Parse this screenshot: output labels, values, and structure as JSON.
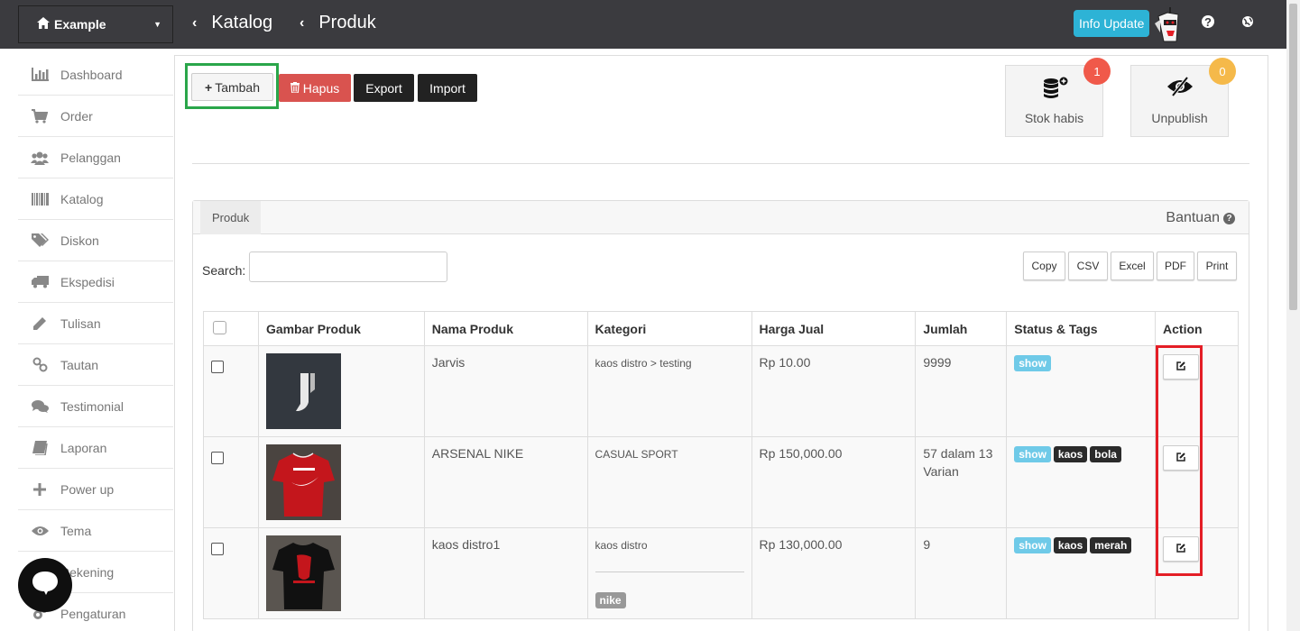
{
  "topbar": {
    "brand_label": "Example",
    "crumb_1": "Katalog",
    "crumb_2": "Produk",
    "info_update": "Info Update",
    "help_icon": "?",
    "globe_icon": "globe-icon"
  },
  "sidebar": {
    "items": [
      {
        "label": "Dashboard",
        "icon": "bar-chart-icon"
      },
      {
        "label": "Order",
        "icon": "cart-icon"
      },
      {
        "label": "Pelanggan",
        "icon": "users-icon"
      },
      {
        "label": "Katalog",
        "icon": "barcode-icon"
      },
      {
        "label": "Diskon",
        "icon": "tags-icon"
      },
      {
        "label": "Ekspedisi",
        "icon": "truck-icon"
      },
      {
        "label": "Tulisan",
        "icon": "pencil-icon"
      },
      {
        "label": "Tautan",
        "icon": "link-icon"
      },
      {
        "label": "Testimonial",
        "icon": "comments-icon"
      },
      {
        "label": "Laporan",
        "icon": "book-icon"
      },
      {
        "label": "Power up",
        "icon": "plus-icon"
      },
      {
        "label": "Tema",
        "icon": "eye-icon"
      },
      {
        "label": "Rekening",
        "icon": "bank-icon"
      },
      {
        "label": "Pengaturan",
        "icon": "cogs-icon"
      }
    ]
  },
  "toolbar": {
    "tambah": "Tambah",
    "hapus": "Hapus",
    "export": "Export",
    "import": "Import"
  },
  "stats": {
    "stok_habis": {
      "label": "Stok habis",
      "count": "1",
      "color": "#f0594a"
    },
    "unpublish": {
      "label": "Unpublish",
      "count": "0",
      "color": "#f5b94a"
    }
  },
  "panel": {
    "tab": "Produk",
    "bantuan": "Bantuan",
    "search_label": "Search:",
    "search_value": "",
    "export_buttons": [
      "Copy",
      "CSV",
      "Excel",
      "PDF",
      "Print"
    ]
  },
  "table": {
    "headers": [
      "Gambar Produk",
      "Nama Produk",
      "Kategori",
      "Harga Jual",
      "Jumlah",
      "Status & Tags",
      "Action"
    ],
    "rows": [
      {
        "name": "Jarvis",
        "kategori": "kaos distro > testing",
        "harga": "Rp 10.00",
        "jumlah": "9999",
        "tags": [
          "show"
        ]
      },
      {
        "name": "ARSENAL NIKE",
        "kategori": "CASUAL SPORT",
        "harga": "Rp 150,000.00",
        "jumlah": "57 dalam 13 Varian",
        "tags": [
          "show",
          "kaos",
          "bola"
        ]
      },
      {
        "name": "kaos distro1",
        "kategori": "kaos distro",
        "kategori_tag": "nike",
        "harga": "Rp 130,000.00",
        "jumlah": "9",
        "tags": [
          "show",
          "kaos",
          "merah"
        ]
      }
    ]
  },
  "colors": {
    "topbar": "#3b3b3f",
    "danger": "#d9534f",
    "dark": "#222222",
    "tag_show": "#6fcae8",
    "info": "#2db3d6"
  }
}
